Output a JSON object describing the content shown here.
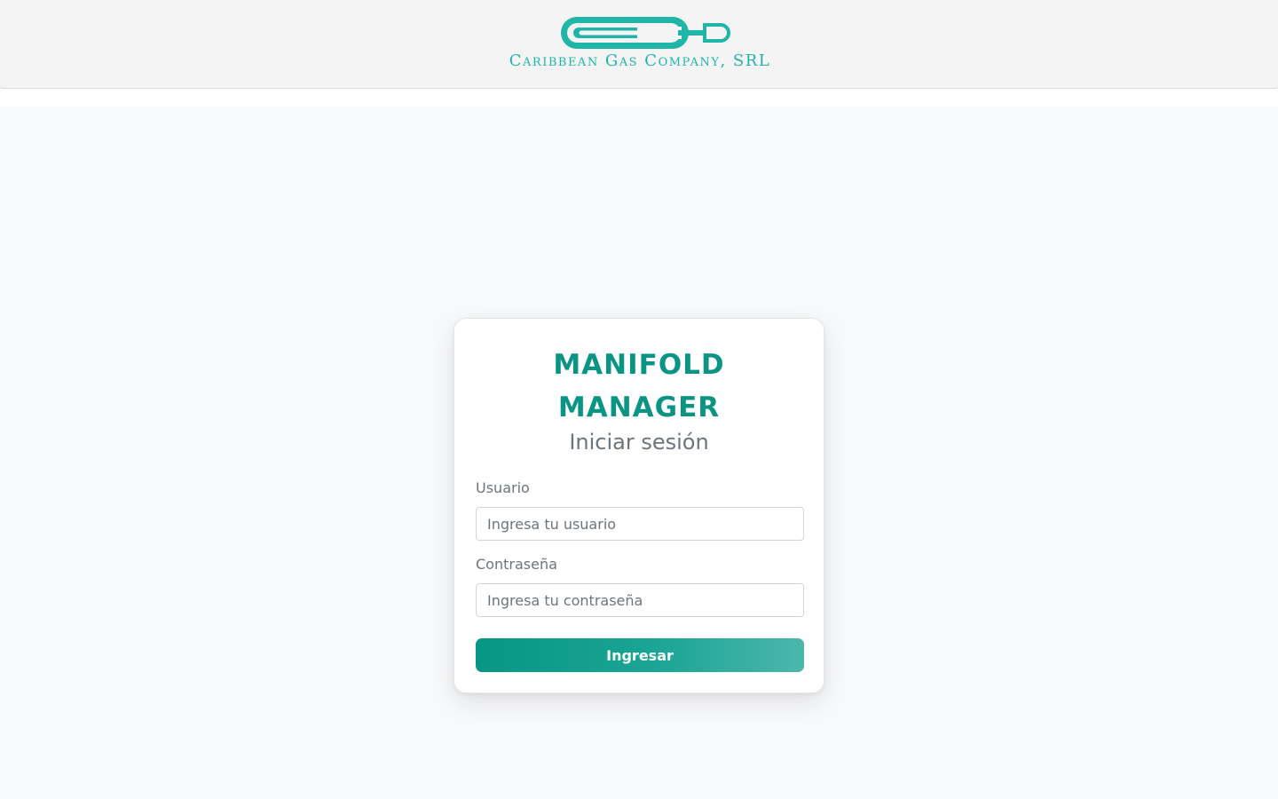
{
  "brand": {
    "name": "Caribbean Gas Company, SRL",
    "logo_icon": "gas-cylinder-logo-icon",
    "color": "#1fb5a8"
  },
  "login": {
    "title_line1": "MANIFOLD",
    "title_line2": "MANAGER",
    "subtitle": "Iniciar sesión",
    "username_label": "Usuario",
    "username_placeholder": "Ingresa tu usuario",
    "username_value": "",
    "password_label": "Contraseña",
    "password_placeholder": "Ingresa tu contraseña",
    "password_value": "",
    "submit_label": "Ingresar",
    "accent_color": "#0a9484"
  }
}
